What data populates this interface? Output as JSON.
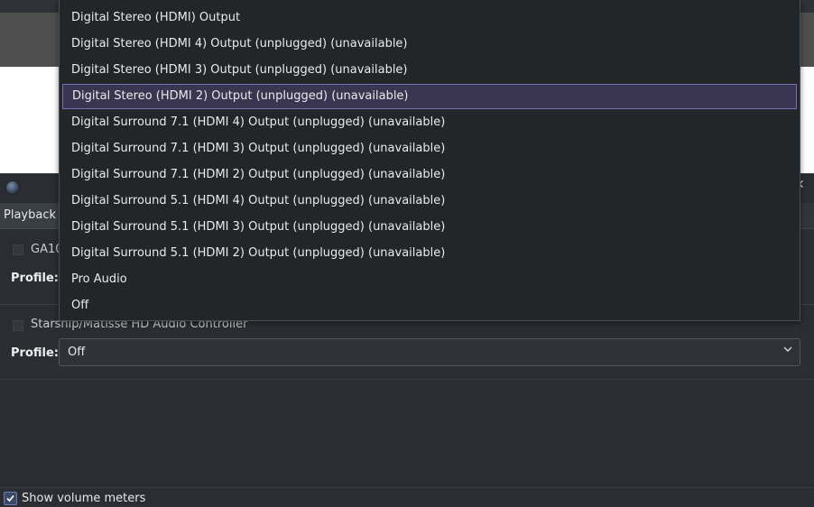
{
  "playback_tab": "Playback",
  "devices": [
    {
      "name": "GA10",
      "profile_label": "Profile:"
    },
    {
      "name": "Starship/Matisse HD Audio Controller",
      "profile_label": "Profile:",
      "profile_value": "Off"
    }
  ],
  "dropdown": {
    "items": [
      "Digital Stereo (HDMI) Output",
      "Digital Stereo (HDMI 4) Output (unplugged) (unavailable)",
      "Digital Stereo (HDMI 3) Output (unplugged) (unavailable)",
      "Digital Stereo (HDMI 2) Output (unplugged) (unavailable)",
      "Digital Surround 7.1 (HDMI 4) Output (unplugged) (unavailable)",
      "Digital Surround 7.1 (HDMI 3) Output (unplugged) (unavailable)",
      "Digital Surround 7.1 (HDMI 2) Output (unplugged) (unavailable)",
      "Digital Surround 5.1 (HDMI 4) Output (unplugged) (unavailable)",
      "Digital Surround 5.1 (HDMI 3) Output (unplugged) (unavailable)",
      "Digital Surround 5.1 (HDMI 2) Output (unplugged) (unavailable)",
      "Pro Audio",
      "Off"
    ],
    "highlighted_item": "Digital Stereo (HDMI 2) Output (unplugged) (unavailable)"
  },
  "footer": {
    "show_volume_meters_label": "Show volume meters",
    "show_volume_meters_checked": true
  },
  "colors": {
    "highlight_border": "#7b6fb8",
    "highlight_bg": "#3a3550",
    "checkbox_accent": "#6a7fb0"
  },
  "icons": [
    "app-icon",
    "close-icon",
    "device-icon",
    "chevron-down-icon",
    "checkmark-icon"
  ]
}
